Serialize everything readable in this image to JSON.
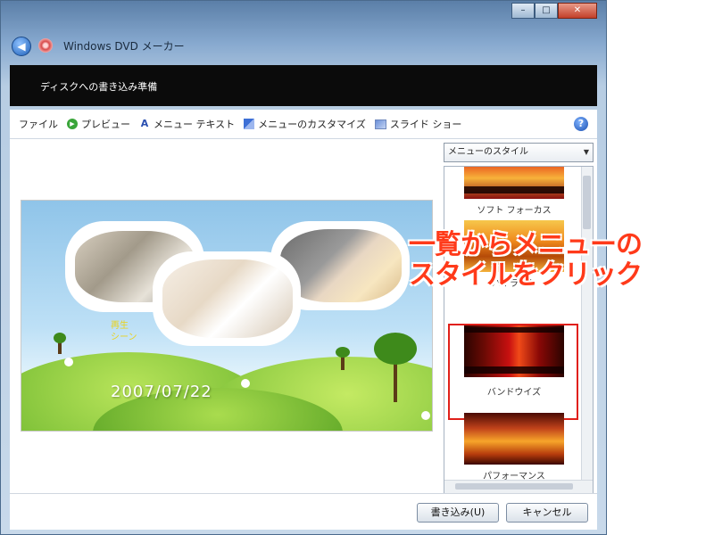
{
  "window": {
    "title": "Windows DVD メーカー",
    "caption_buttons": [
      "minimize",
      "maximize",
      "close"
    ]
  },
  "header": {
    "text": "ディスクへの書き込み準備"
  },
  "toolbar": {
    "items": [
      {
        "label": "ファイル",
        "icon": ""
      },
      {
        "label": "プレビュー",
        "icon": "preview-icon"
      },
      {
        "label": "メニュー テキスト",
        "icon": "menu-text-icon"
      },
      {
        "label": "メニューのカスタマイズ",
        "icon": "customize-icon"
      },
      {
        "label": "スライド ショー",
        "icon": "slideshow-icon"
      }
    ],
    "help": "?"
  },
  "preview": {
    "play_label_line1": "再生",
    "play_label_line2": "シーン",
    "date": "2007/07/22"
  },
  "style_panel": {
    "dropdown_label": "メニューのスタイル",
    "items": [
      {
        "label": "ソフト フォーカス"
      },
      {
        "label": "ハイライト"
      },
      {
        "label": "バンドウイズ",
        "selected": true
      },
      {
        "label": "パフォーマンス"
      }
    ]
  },
  "footer": {
    "burn_label": "書き込み(U)",
    "cancel_label": "キャンセル"
  },
  "annotation": {
    "line1": "一覧からメニューの",
    "line2": "スタイルをクリック"
  },
  "colors": {
    "header_bg": "#0b0b0b",
    "annotation": "#ff3a1a",
    "selection_frame": "#e0201a"
  }
}
